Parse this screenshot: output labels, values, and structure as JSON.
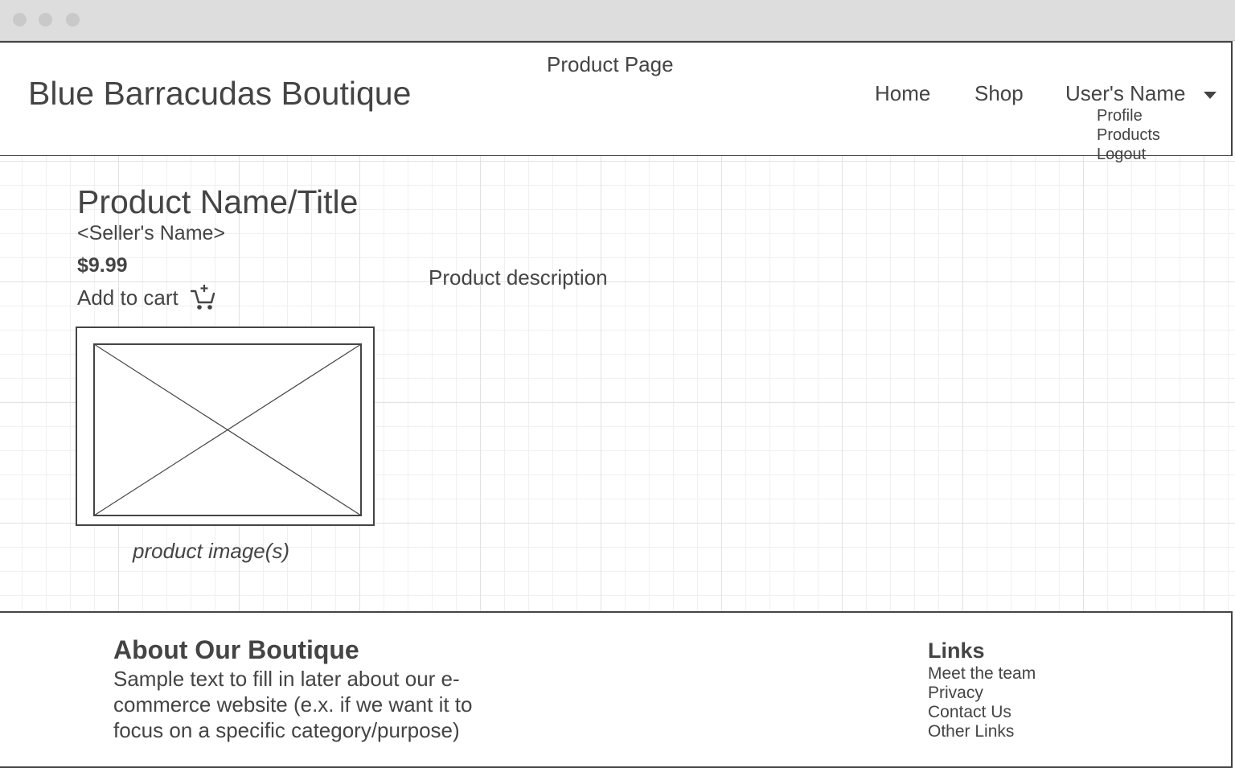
{
  "header": {
    "page_caption": "Product Page",
    "brand": "Blue Barracudas Boutique",
    "nav": {
      "home": "Home",
      "shop": "Shop",
      "user": "User's Name"
    },
    "dropdown": [
      "Profile",
      "Products",
      "Logout"
    ]
  },
  "product": {
    "title": "Product Name/Title",
    "seller": "<Seller's Name>",
    "price": "$9.99",
    "add_to_cart": "Add to cart",
    "cart_icon": "add-to-cart-icon",
    "description": "Product description",
    "image_caption": "product image(s)"
  },
  "footer": {
    "about_title": "About Our Boutique",
    "about_text": "Sample text to fill in later about our e-commerce website (e.x. if we want it to focus on a specific category/purpose)",
    "links_title": "Links",
    "links": [
      "Meet the team",
      "Privacy",
      "Contact Us",
      "Other Links"
    ]
  },
  "colors": {
    "ink": "#444444",
    "titlebar": "#dddddd",
    "grid_major": "#e2e2e2",
    "grid_minor": "#f0f0f0"
  }
}
